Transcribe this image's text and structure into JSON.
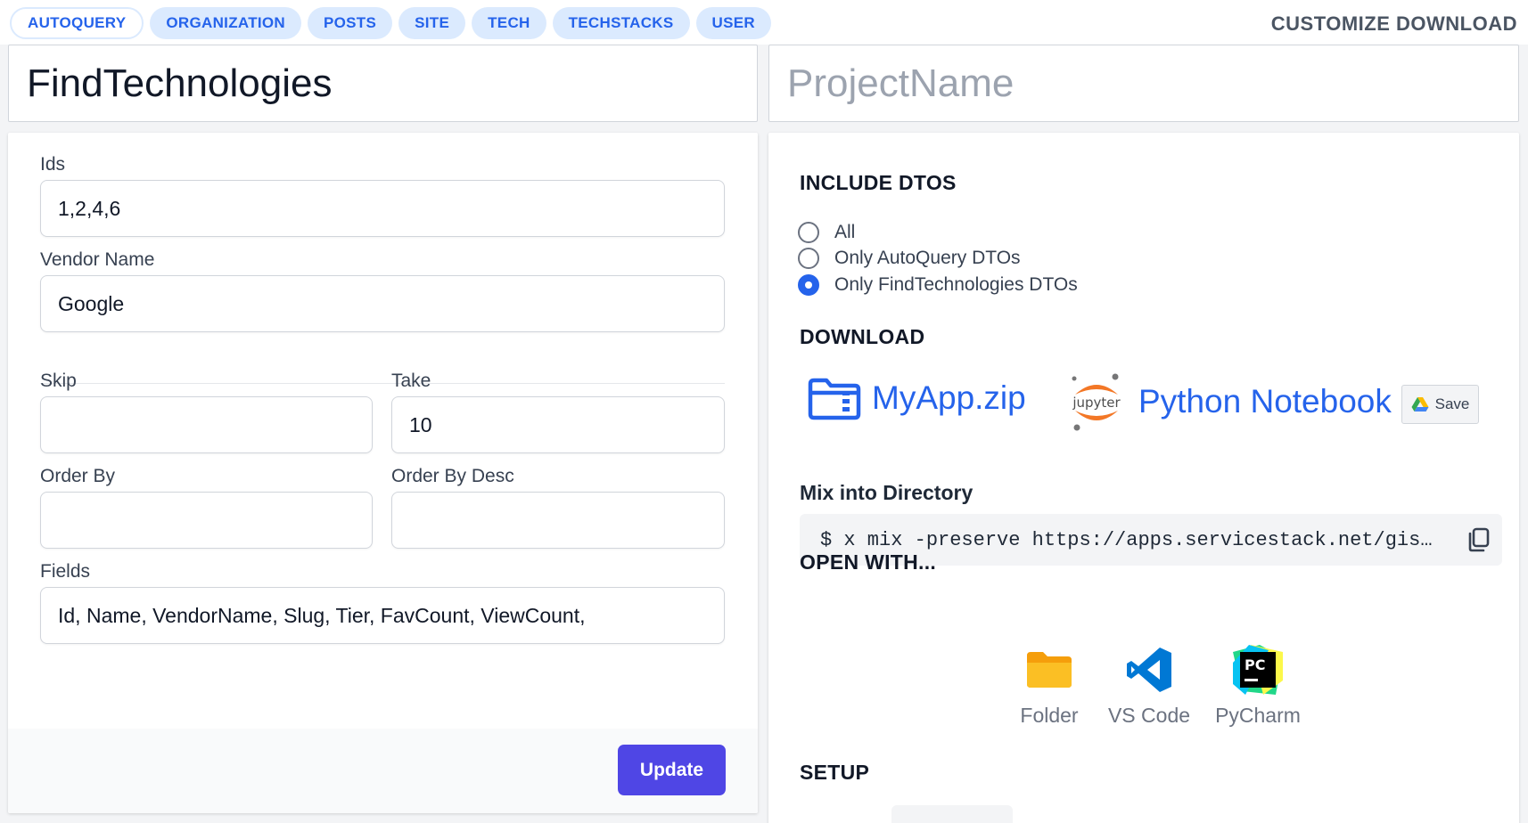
{
  "tabs": [
    "AUTOQUERY",
    "ORGANIZATION",
    "POSTS",
    "SITE",
    "TECH",
    "TECHSTACKS",
    "USER"
  ],
  "active_tab": "AUTOQUERY",
  "customize_label": "CUSTOMIZE DOWNLOAD",
  "operation_title": "FindTechnologies",
  "project_name_placeholder": "ProjectName",
  "form": {
    "ids": {
      "label": "Ids",
      "value": "1,2,4,6"
    },
    "vendor_name": {
      "label": "Vendor Name",
      "value": "Google"
    },
    "skip": {
      "label": "Skip",
      "value": ""
    },
    "take": {
      "label": "Take",
      "value": "10"
    },
    "order_by": {
      "label": "Order By",
      "value": ""
    },
    "order_by_desc": {
      "label": "Order By Desc",
      "value": ""
    },
    "fields": {
      "label": "Fields",
      "value": "Id, Name, VendorName, Slug, Tier, FavCount, ViewCount,"
    },
    "update_label": "Update"
  },
  "include_dtos": {
    "heading": "INCLUDE DTOS",
    "options": [
      "All",
      "Only AutoQuery DTOs",
      "Only FindTechnologies DTOs"
    ],
    "selected": "Only FindTechnologies DTOs"
  },
  "download": {
    "heading": "DOWNLOAD",
    "zip_label": "MyApp.zip",
    "jupyter_logo_text": "jupyter",
    "notebook_label": "Python Notebook",
    "save_label": "Save"
  },
  "mix": {
    "label": "Mix into Directory",
    "command": "$ x mix -preserve https://apps.servicestack.net/gist/..."
  },
  "open_with": {
    "heading": "OPEN WITH...",
    "items": [
      {
        "label": "Folder",
        "icon": "folder-icon"
      },
      {
        "label": "VS Code",
        "icon": "vscode-icon"
      },
      {
        "label": "PyCharm",
        "icon": "pycharm-icon"
      }
    ]
  },
  "setup_heading": "SETUP",
  "colors": {
    "accent": "#2563eb",
    "tab_bg": "#dbeafe",
    "update_button": "#4f46e5",
    "folder": "#fbbf24",
    "vscode": "#0078d4"
  }
}
